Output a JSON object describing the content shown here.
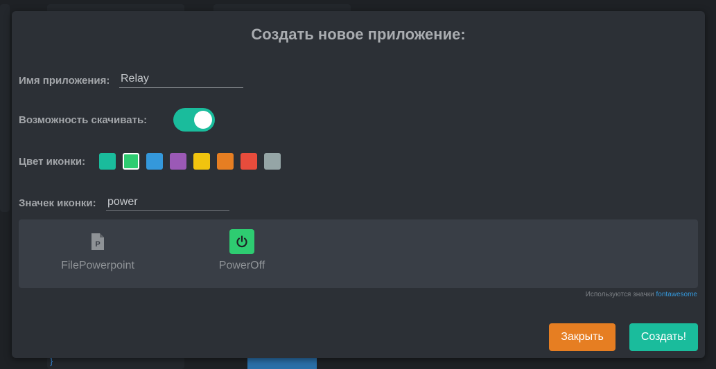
{
  "modal": {
    "title": "Создать новое приложение:",
    "app_name_label": "Имя приложения:",
    "app_name_value": "Relay",
    "download_label": "Возможность скачивать:",
    "download_enabled": true,
    "icon_color_label": "Цвет иконки:",
    "colors": [
      "#1abc9c",
      "#2ecc71",
      "#3498db",
      "#9b59b6",
      "#f1c40f",
      "#e67e22",
      "#e74c3c",
      "#95a5a6"
    ],
    "selected_color": "#2ecc71",
    "icon_label": "Значек иконки:",
    "icon_search_value": "power",
    "icons": [
      {
        "name": "FilePowerpoint",
        "icon": "file-powerpoint-icon",
        "selected": false
      },
      {
        "name": "PowerOff",
        "icon": "power-off-icon",
        "selected": true
      }
    ],
    "credit_text": "Используются значки",
    "credit_link": "fontawesome",
    "close_label": "Закрыть",
    "create_label": "Создать!"
  }
}
